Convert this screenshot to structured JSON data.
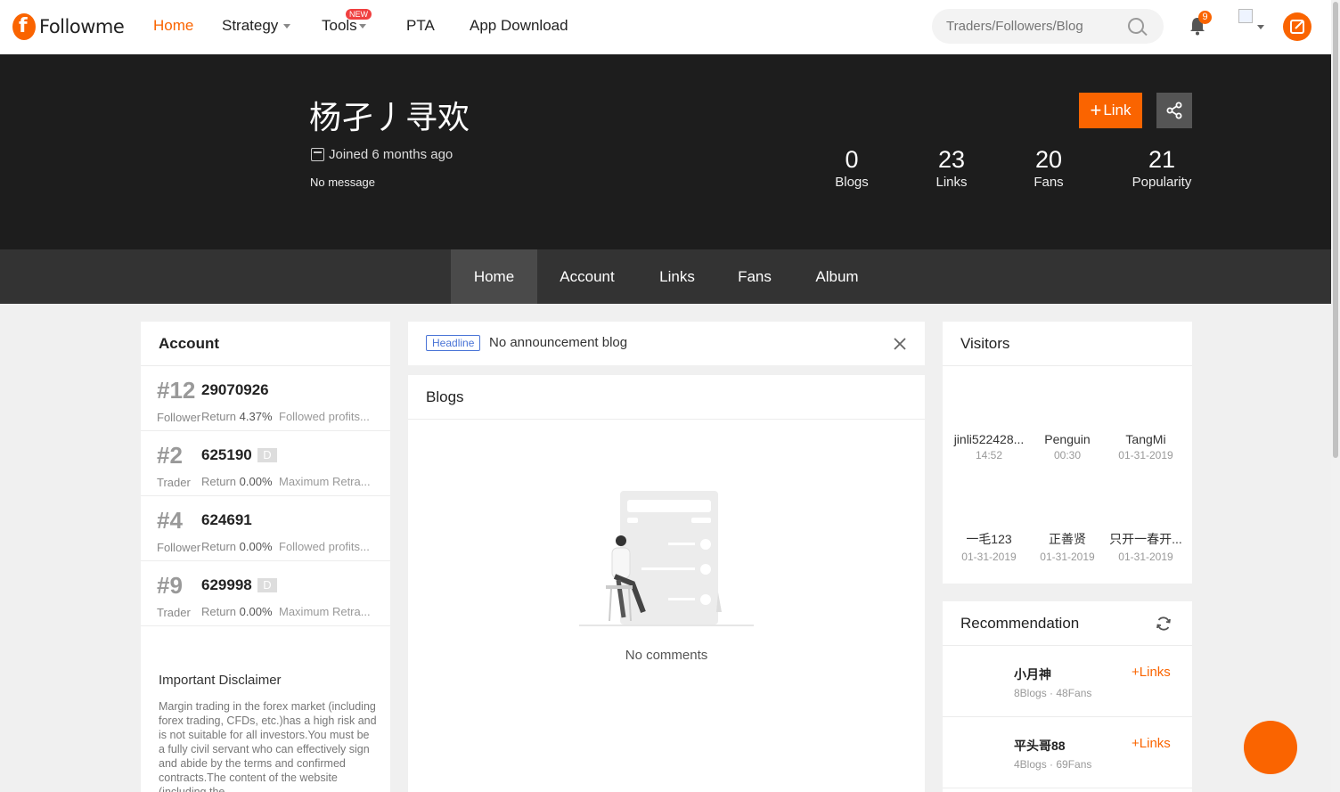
{
  "nav": {
    "logo_text": "Followme",
    "items": [
      "Home",
      "Strategy",
      "Tools",
      "PTA",
      "App Download"
    ],
    "tools_badge": "NEW",
    "search_placeholder": "Traders/Followers/Blog",
    "notification_count": "9",
    "accent_color": "#fa6400"
  },
  "profile": {
    "name": "杨孑丿寻欢",
    "joined": "Joined 6 months ago",
    "message": "No message",
    "link_button": "Link",
    "stats": [
      {
        "value": "0",
        "label": "Blogs"
      },
      {
        "value": "23",
        "label": "Links"
      },
      {
        "value": "20",
        "label": "Fans"
      },
      {
        "value": "21",
        "label": "Popularity"
      }
    ]
  },
  "tabs": [
    "Home",
    "Account",
    "Links",
    "Fans",
    "Album"
  ],
  "account": {
    "title": "Account",
    "rows": [
      {
        "rank": "#12",
        "number": "29070926",
        "tag": "",
        "type": "Follower",
        "return_label": "Return",
        "return_value": "4.37%",
        "extra": "Followed profits..."
      },
      {
        "rank": "#2",
        "number": "625190",
        "tag": "D",
        "type": "Trader",
        "return_label": "Return",
        "return_value": "0.00%",
        "extra": "Maximum Retra..."
      },
      {
        "rank": "#4",
        "number": "624691",
        "tag": "",
        "type": "Follower",
        "return_label": "Return",
        "return_value": "0.00%",
        "extra": "Followed profits..."
      },
      {
        "rank": "#9",
        "number": "629998",
        "tag": "D",
        "type": "Trader",
        "return_label": "Return",
        "return_value": "0.00%",
        "extra": "Maximum Retra..."
      }
    ],
    "disclaimer_title": "Important Disclaimer",
    "disclaimer_text": "Margin trading in the forex market (including forex trading, CFDs, etc.)has a high risk and is not suitable for all investors.You must be a fully civil servant who can effectively sign and abide by the terms and confirmed contracts.The content of the website (including the"
  },
  "announcement": {
    "tag": "Headline",
    "text": "No announcement blog"
  },
  "blogs": {
    "title": "Blogs",
    "empty_text": "No comments"
  },
  "visitors": {
    "title": "Visitors",
    "items": [
      {
        "name": "jinli522428...",
        "time": "14:52"
      },
      {
        "name": "Penguin",
        "time": "00:30"
      },
      {
        "name": "TangMi",
        "time": "01-31-2019"
      },
      {
        "name": "一毛123",
        "time": "01-31-2019"
      },
      {
        "name": "正善贤",
        "time": "01-31-2019"
      },
      {
        "name": "只开一春开...",
        "time": "01-31-2019"
      }
    ]
  },
  "recommendation": {
    "title": "Recommendation",
    "items": [
      {
        "name": "小月神",
        "meta": "8Blogs · 48Fans",
        "action": "Links"
      },
      {
        "name": "平头哥88",
        "meta": "4Blogs · 69Fans",
        "action": "Links"
      }
    ]
  }
}
